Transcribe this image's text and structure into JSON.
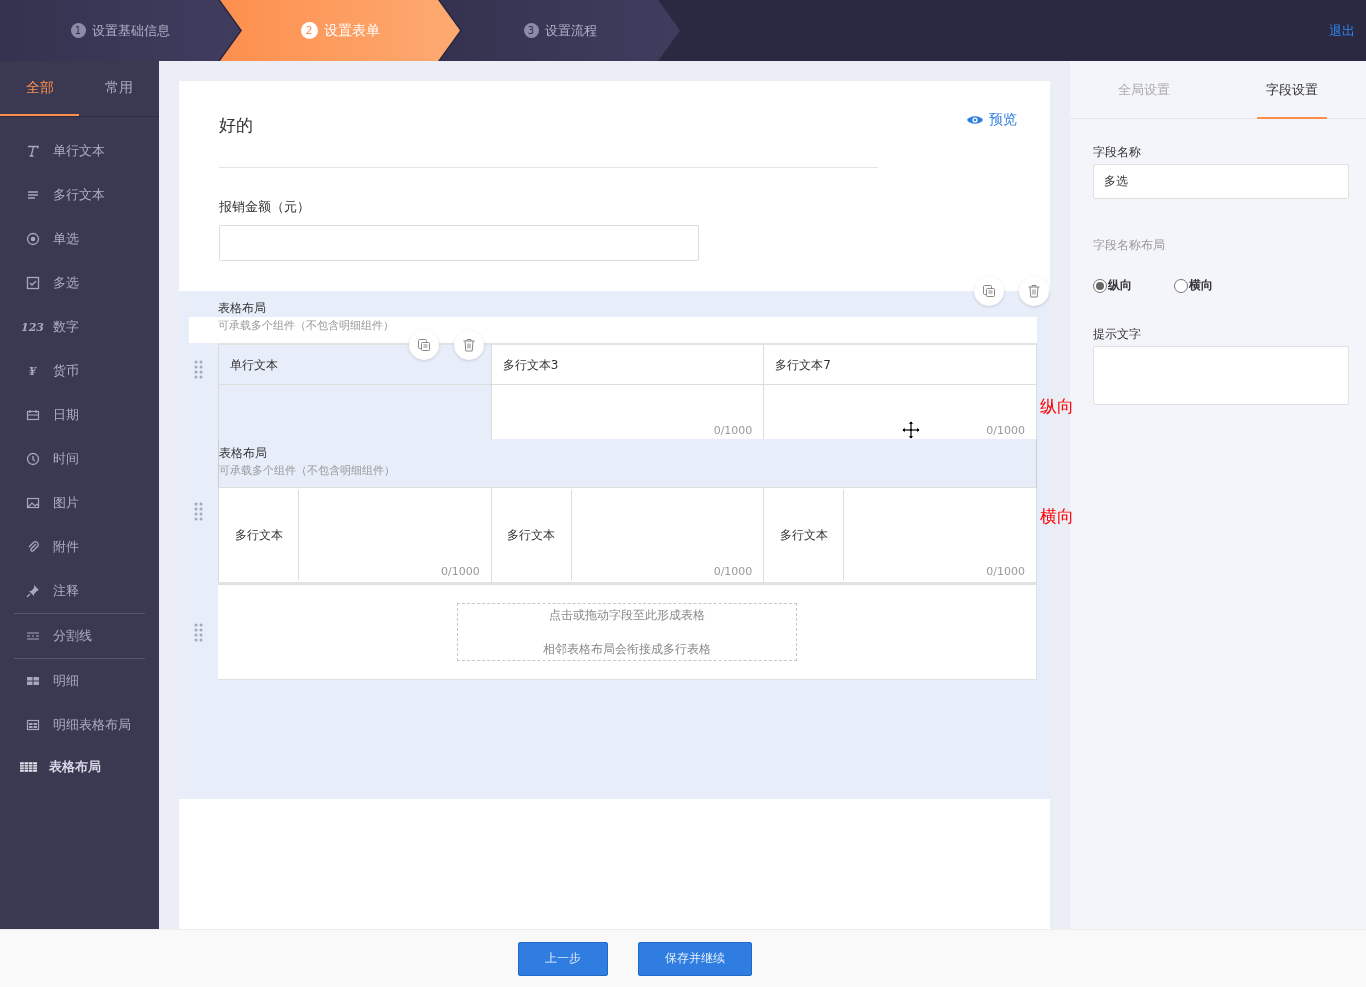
{
  "steps": [
    {
      "number": "1",
      "label": "设置基础信息",
      "selected": false
    },
    {
      "number": "2",
      "label": "设置表单",
      "selected": true
    },
    {
      "number": "3",
      "label": "设置流程",
      "selected": false
    }
  ],
  "exit": "退出",
  "sidebar": {
    "tabs": [
      {
        "label": "全部",
        "selected": true
      },
      {
        "label": "常用",
        "selected": false
      }
    ],
    "groups": [
      [
        {
          "kind": "text",
          "label": "单行文本",
          "selected": false
        },
        {
          "kind": "lines",
          "label": "多行文本",
          "selected": false
        },
        {
          "kind": "radio",
          "label": "单选",
          "selected": false
        },
        {
          "kind": "checkbox",
          "label": "多选",
          "selected": false
        },
        {
          "kind": "glyph",
          "glyph": "123",
          "label": "数字",
          "selected": false
        },
        {
          "kind": "glyph",
          "glyph": "¥",
          "label": "货币",
          "selected": false
        },
        {
          "kind": "calendar",
          "label": "日期",
          "selected": false
        },
        {
          "kind": "clock",
          "label": "时间",
          "selected": false
        },
        {
          "kind": "image",
          "label": "图片",
          "selected": false
        },
        {
          "kind": "clip",
          "label": "附件",
          "selected": false
        },
        {
          "kind": "pin",
          "label": "注释",
          "selected": false
        }
      ],
      [
        {
          "kind": "dashes",
          "label": "分割线",
          "selected": false
        }
      ],
      [
        {
          "kind": "grid",
          "label": "明细",
          "selected": false
        },
        {
          "kind": "table",
          "label": "明细表格布局",
          "selected": false
        },
        {
          "kind": "bigtable",
          "label": "表格布局",
          "selected": true
        }
      ]
    ]
  },
  "form": {
    "title": "好的",
    "preview": "预览",
    "fields": [
      {
        "label": "报销金额（元）"
      }
    ],
    "layouts": [
      {
        "kind": "vertical",
        "selected": true,
        "title": "表格布局",
        "hint": "可承载多个组件（不包含明细组件）",
        "annotation": "纵向",
        "cells": [
          {
            "label": "单行文本",
            "selected": true
          },
          {
            "label": "多行文本3",
            "counter": "0/1000",
            "selected": false
          },
          {
            "label": "多行文本7",
            "counter": "0/1000",
            "selected": false
          }
        ]
      },
      {
        "kind": "horizontal",
        "selected": false,
        "title": "表格布局",
        "hint": "可承载多个组件（不包含明细组件）",
        "annotation": "横向",
        "cells": [
          {
            "label": "多行文本",
            "counter": "0/1000",
            "selected": false
          },
          {
            "label": "多行文本",
            "counter": "0/1000",
            "selected": false
          },
          {
            "label": "多行文本",
            "counter": "0/1000",
            "selected": false
          }
        ]
      },
      {
        "kind": "drop",
        "lines": [
          "点击或拖动字段至此形成表格",
          "相邻表格布局会衔接成多行表格"
        ]
      }
    ]
  },
  "settings": {
    "tabs": [
      {
        "label": "全局设置",
        "selected": false
      },
      {
        "label": "字段设置",
        "selected": true
      }
    ],
    "name_label": "字段名称",
    "name_value": "多选",
    "layout_label": "字段名称布局",
    "options": [
      {
        "label": "纵向",
        "selected": true
      },
      {
        "label": "横向",
        "selected": false
      }
    ],
    "hint_label": "提示文字"
  },
  "footer": {
    "buttons": [
      "上一步",
      "保存并继续"
    ]
  }
}
